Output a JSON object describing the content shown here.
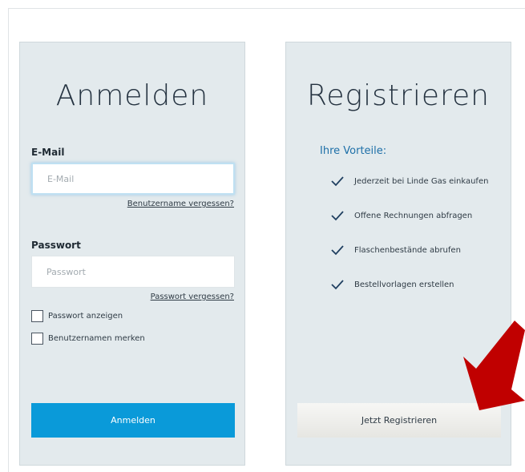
{
  "login": {
    "title": "Anmelden",
    "email_label": "E-Mail",
    "email_placeholder": "E-Mail",
    "forgot_username": "Benutzername vergessen?",
    "password_label": "Passwort",
    "password_placeholder": "Passwort",
    "forgot_password": "Passwort vergessen?",
    "show_password": "Passwort anzeigen",
    "remember_username": "Benutzernamen merken",
    "submit": "Anmelden"
  },
  "register": {
    "title": "Registrieren",
    "benefits_heading": "Ihre Vorteile:",
    "benefits": [
      "Jederzeit bei Linde Gas einkaufen",
      "Offene Rechnungen abfragen",
      "Flaschenbestände abrufen",
      "Bestellvorlagen erstellen"
    ],
    "submit": "Jetzt Registrieren"
  },
  "colors": {
    "primary_button": "#0a9ad9",
    "panel_background": "#e3eaed",
    "accent_heading": "#1d6fa8",
    "arrow": "#c00000"
  },
  "icons": {
    "benefit": "checkmark-icon",
    "annotation": "red-arrow-icon"
  }
}
